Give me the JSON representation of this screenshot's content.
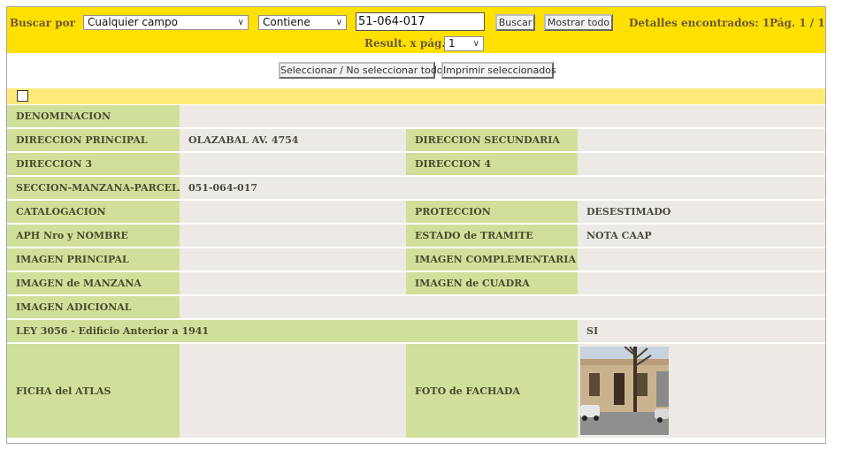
{
  "search": {
    "label": "Buscar por",
    "field_value": "Cualquier campo",
    "operator_value": "Contiene",
    "query_value": "51-064-017",
    "search_button": "Buscar",
    "show_all_button": "Mostrar todo",
    "results_found": "Detalles encontrados: 1",
    "page_info": "Pág. 1 / 1",
    "results_per_page_label": "Result. x pág.:",
    "results_per_page_value": "1"
  },
  "actions": {
    "select_toggle": "Seleccionar / No seleccionar todo",
    "print_selected": "Imprimir seleccionados"
  },
  "record": {
    "denominacion": {
      "label": "DENOMINACION",
      "value": ""
    },
    "direccion_principal": {
      "label": "DIRECCION PRINCIPAL",
      "value": "OLAZABAL AV. 4754"
    },
    "direccion_secundaria": {
      "label": "DIRECCION SECUNDARIA",
      "value": ""
    },
    "direccion_3": {
      "label": "DIRECCION 3",
      "value": ""
    },
    "direccion_4": {
      "label": "DIRECCION 4",
      "value": ""
    },
    "seccion": {
      "label": "SECCION-MANZANA-PARCELA",
      "value": "051-064-017"
    },
    "catalogacion": {
      "label": "CATALOGACION",
      "value": ""
    },
    "proteccion": {
      "label": "PROTECCION",
      "value": "DESESTIMADO"
    },
    "aph": {
      "label": "APH Nro y NOMBRE",
      "value": ""
    },
    "estado_tramite": {
      "label": "ESTADO de TRAMITE",
      "value": "NOTA CAAP"
    },
    "imagen_principal": {
      "label": "IMAGEN PRINCIPAL",
      "value": ""
    },
    "imagen_complementaria": {
      "label": "IMAGEN COMPLEMENTARIA",
      "value": ""
    },
    "imagen_manzana": {
      "label": "IMAGEN de MANZANA",
      "value": ""
    },
    "imagen_cuadra": {
      "label": "IMAGEN de CUADRA",
      "value": ""
    },
    "imagen_adicional": {
      "label": "IMAGEN ADICIONAL",
      "value": ""
    },
    "ley_3056": {
      "label": "LEY 3056 - Edificio Anterior a 1941",
      "value": "SI"
    },
    "ficha_atlas": {
      "label": "FICHA del ATLAS",
      "value": ""
    },
    "foto_fachada": {
      "label": "FOTO de FACHADA"
    }
  },
  "colors": {
    "toolbar_bg": "#ffe000",
    "label_cell_bg": "#d0e09a",
    "value_cell_bg": "#edeae5"
  }
}
